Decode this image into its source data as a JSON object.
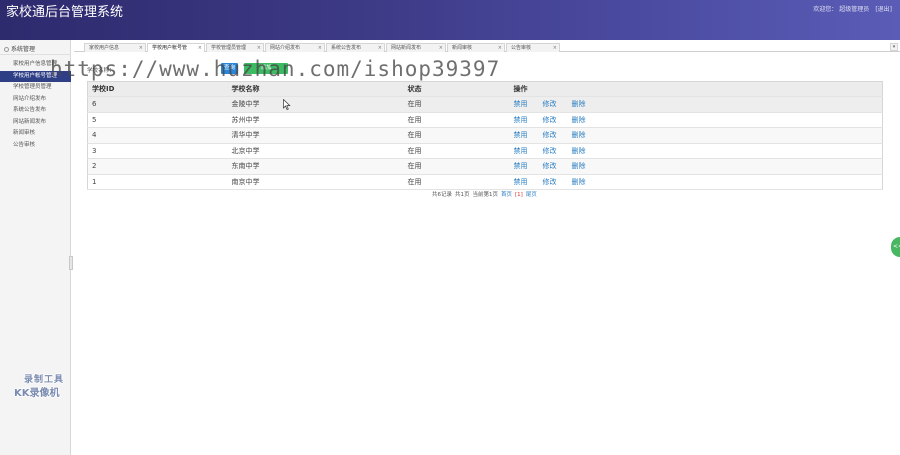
{
  "header": {
    "title": "家校通后台管理系统",
    "welcome_label": "欢迎您：",
    "user": "超级管理员",
    "logout": "[退出]"
  },
  "sidebar": {
    "section": "系统管理",
    "items": [
      {
        "label": "家校用户信息管理"
      },
      {
        "label": "学校用户帐号管理"
      },
      {
        "label": "学校管理员管理"
      },
      {
        "label": "网站介绍发布"
      },
      {
        "label": "系统公告发布"
      },
      {
        "label": "网站新闻发布"
      },
      {
        "label": "新闻审核"
      },
      {
        "label": "公告审核"
      }
    ],
    "active_index": 1
  },
  "tabs": [
    {
      "label": "家校用户信息"
    },
    {
      "label": "学校用户帐号管"
    },
    {
      "label": "学校管理员管理"
    },
    {
      "label": "网站介绍发布"
    },
    {
      "label": "系统公告发布"
    },
    {
      "label": "网站新闻发布"
    },
    {
      "label": "新闻审核"
    },
    {
      "label": "公告审核"
    }
  ],
  "tab_close_glyph": "×",
  "toolbar": {
    "label": "学校名称：",
    "search_button": "查询",
    "add_button": "添加"
  },
  "table": {
    "columns": [
      "学校ID",
      "学校名称",
      "状态",
      "操作"
    ],
    "rows": [
      {
        "id": "6",
        "name": "金陵中学",
        "status": "在用"
      },
      {
        "id": "5",
        "name": "苏州中学",
        "status": "在用"
      },
      {
        "id": "4",
        "name": "清华中学",
        "status": "在用"
      },
      {
        "id": "3",
        "name": "北京中学",
        "status": "在用"
      },
      {
        "id": "2",
        "name": "东南中学",
        "status": "在用"
      },
      {
        "id": "1",
        "name": "南京中学",
        "status": "在用"
      }
    ],
    "actions": {
      "disable": "禁用",
      "edit": "修改",
      "delete": "删除"
    }
  },
  "pager": {
    "total": "共6记录",
    "pages": "共1页",
    "current": "当前第1页",
    "first": "首页",
    "page_num": "[1]",
    "last": "尾页"
  },
  "watermark": "https://www.huzhan.com/ishop39397",
  "badge": {
    "line1": "录制工具",
    "line2": "KK录像机"
  },
  "float_button": "<<",
  "colors": {
    "header_start": "#2e2a6e",
    "header_end": "#5a5cb6",
    "sidebar_active": "#2f3f86",
    "search_button": "#2a86d8",
    "add_button": "#3dbb63",
    "link": "#2a7ec2",
    "current_page": "#d9332b",
    "float_button": "#47b761"
  }
}
